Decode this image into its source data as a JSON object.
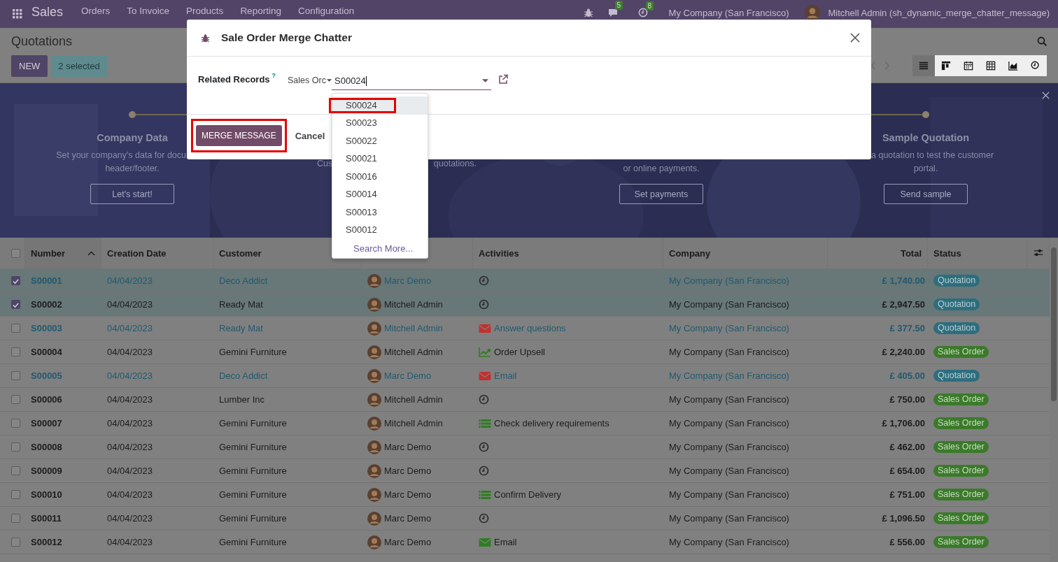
{
  "navbar": {
    "app": "Sales",
    "menus": [
      "Orders",
      "To Invoice",
      "Products",
      "Reporting",
      "Configuration"
    ],
    "chat_count": "5",
    "activity_count": "8",
    "company": "My Company (San Francisco)",
    "user": "Mitchell Admin (sh_dynamic_merge_chatter_message)"
  },
  "control_panel": {
    "title": "Quotations",
    "new_button": "NEW",
    "selection": "2 selected",
    "views": [
      {
        "kind": "list",
        "selected": true
      },
      {
        "kind": "kanban",
        "selected": false
      },
      {
        "kind": "calendar",
        "selected": false
      },
      {
        "kind": "pivot",
        "selected": false
      },
      {
        "kind": "graph",
        "selected": false
      },
      {
        "kind": "activity",
        "selected": false
      }
    ]
  },
  "onboarding": {
    "steps": [
      {
        "title": "Company Data",
        "lines": [
          "Set your company's data for docu",
          "header/footer."
        ],
        "button": "Let's start!"
      },
      {
        "fragments": [
          "Cus",
          "quotations."
        ]
      },
      {
        "lines": [
          "or online payments."
        ],
        "button": "Set payments"
      },
      {
        "title": "Sample Quotation",
        "lines": [
          "a quotation to test the customer",
          "portal."
        ],
        "button": "Send sample"
      }
    ]
  },
  "table": {
    "all_selected": false,
    "columns": [
      {
        "label": "Number",
        "sorted": true
      },
      {
        "label": "Creation Date",
        "sorted": false
      },
      {
        "label": "Customer",
        "sorted": false
      },
      {
        "sorted": false
      },
      {
        "label": "Activities",
        "sorted": false
      },
      {
        "label": "Company",
        "sorted": false
      },
      {
        "label": "Total",
        "sorted": false
      },
      {
        "label": "Status",
        "sorted": false
      }
    ],
    "rows": [
      {
        "selected": true,
        "info": true,
        "number": "S00001",
        "date": "04/04/2023",
        "customer": "Deco Addict",
        "column_4": "Marc Demo",
        "activity": {
          "kind": "clock"
        },
        "company": "My Company (San Francisco)",
        "total": "£ 1,740.00",
        "status": {
          "kind": "quotation",
          "label": "Quotation"
        }
      },
      {
        "selected": true,
        "info": false,
        "number": "S00002",
        "date": "04/04/2023",
        "customer": "Ready Mat",
        "column_4": "Mitchell Admin",
        "activity": {
          "kind": "clock"
        },
        "company": "My Company (San Francisco)",
        "total": "£ 2,947.50",
        "status": {
          "kind": "quotation",
          "label": "Quotation"
        }
      },
      {
        "selected": false,
        "info": true,
        "number": "S00003",
        "date": "04/04/2023",
        "customer": "Ready Mat",
        "column_4": "Mitchell Admin",
        "activity": {
          "kind": "email",
          "overdue": true,
          "label": "Answer questions"
        },
        "company": "My Company (San Francisco)",
        "total": "£ 377.50",
        "status": {
          "kind": "quotation",
          "label": "Quotation"
        }
      },
      {
        "selected": false,
        "info": false,
        "number": "S00004",
        "date": "04/04/2023",
        "customer": "Gemini Furniture",
        "column_4": "Mitchell Admin",
        "activity": {
          "kind": "upsell",
          "overdue": false,
          "label": "Order Upsell"
        },
        "company": "My Company (San Francisco)",
        "total": "£ 2,240.00",
        "status": {
          "kind": "sales_order",
          "label": "Sales Order"
        }
      },
      {
        "selected": false,
        "info": true,
        "number": "S00005",
        "date": "04/04/2023",
        "customer": "Deco Addict",
        "column_4": "Marc Demo",
        "activity": {
          "kind": "email",
          "overdue": true,
          "label": "Email"
        },
        "company": "My Company (San Francisco)",
        "total": "£ 405.00",
        "status": {
          "kind": "quotation",
          "label": "Quotation"
        }
      },
      {
        "selected": false,
        "info": false,
        "number": "S00006",
        "date": "04/04/2023",
        "customer": "Lumber Inc",
        "column_4": "Mitchell Admin",
        "activity": {
          "kind": "clock"
        },
        "company": "My Company (San Francisco)",
        "total": "£ 750.00",
        "status": {
          "kind": "sales_order",
          "label": "Sales Order"
        }
      },
      {
        "selected": false,
        "info": false,
        "number": "S00007",
        "date": "04/04/2023",
        "customer": "Gemini Furniture",
        "column_4": "Mitchell Admin",
        "activity": {
          "kind": "todo",
          "overdue": false,
          "label": "Check delivery requirements"
        },
        "company": "My Company (San Francisco)",
        "total": "£ 1,706.00",
        "status": {
          "kind": "sales_order",
          "label": "Sales Order"
        }
      },
      {
        "selected": false,
        "info": false,
        "number": "S00008",
        "date": "04/04/2023",
        "customer": "Gemini Furniture",
        "column_4": "Marc Demo",
        "activity": {
          "kind": "clock"
        },
        "company": "My Company (San Francisco)",
        "total": "£ 462.00",
        "status": {
          "kind": "sales_order",
          "label": "Sales Order"
        }
      },
      {
        "selected": false,
        "info": false,
        "number": "S00009",
        "date": "04/04/2023",
        "customer": "Gemini Furniture",
        "column_4": "Marc Demo",
        "activity": {
          "kind": "clock"
        },
        "company": "My Company (San Francisco)",
        "total": "£ 654.00",
        "status": {
          "kind": "sales_order",
          "label": "Sales Order"
        }
      },
      {
        "selected": false,
        "info": false,
        "number": "S00010",
        "date": "04/04/2023",
        "customer": "Gemini Furniture",
        "column_4": "Marc Demo",
        "activity": {
          "kind": "todo",
          "overdue": false,
          "label": "Confirm Delivery"
        },
        "company": "My Company (San Francisco)",
        "total": "£ 751.00",
        "status": {
          "kind": "sales_order",
          "label": "Sales Order"
        }
      },
      {
        "selected": false,
        "info": false,
        "number": "S00011",
        "date": "04/04/2023",
        "customer": "Gemini Furniture",
        "column_4": "Marc Demo",
        "activity": {
          "kind": "clock"
        },
        "company": "My Company (San Francisco)",
        "total": "£ 1,096.50",
        "status": {
          "kind": "sales_order",
          "label": "Sales Order"
        }
      },
      {
        "selected": false,
        "info": false,
        "number": "S00012",
        "date": "04/04/2023",
        "customer": "Gemini Furniture",
        "column_4": "Marc Demo",
        "activity": {
          "kind": "email",
          "overdue": false,
          "label": "Email"
        },
        "company": "My Company (San Francisco)",
        "total": "£ 556.00",
        "status": {
          "kind": "sales_order",
          "label": "Sales Order"
        }
      }
    ]
  },
  "dialog": {
    "title": "Sale Order Merge Chatter",
    "field_label": "Related Records",
    "help_mark": "?",
    "model_select": "Sales Orc",
    "value": "S00024",
    "options": [
      {
        "label": "S00024",
        "selected": true,
        "highlighted": true
      },
      {
        "label": "S00023",
        "selected": false,
        "highlighted": false
      },
      {
        "label": "S00022",
        "selected": false,
        "highlighted": false
      },
      {
        "label": "S00021",
        "selected": false,
        "highlighted": false
      },
      {
        "label": "S00016",
        "selected": false,
        "highlighted": false
      },
      {
        "label": "S00014",
        "selected": false,
        "highlighted": false
      },
      {
        "label": "S00013",
        "selected": false,
        "highlighted": false
      },
      {
        "label": "S00012",
        "selected": false,
        "highlighted": false
      }
    ],
    "search_more": "Search More...",
    "primary_button": {
      "label": "MERGE MESSAGE",
      "highlighted": true
    },
    "cancel_button": "Cancel"
  }
}
